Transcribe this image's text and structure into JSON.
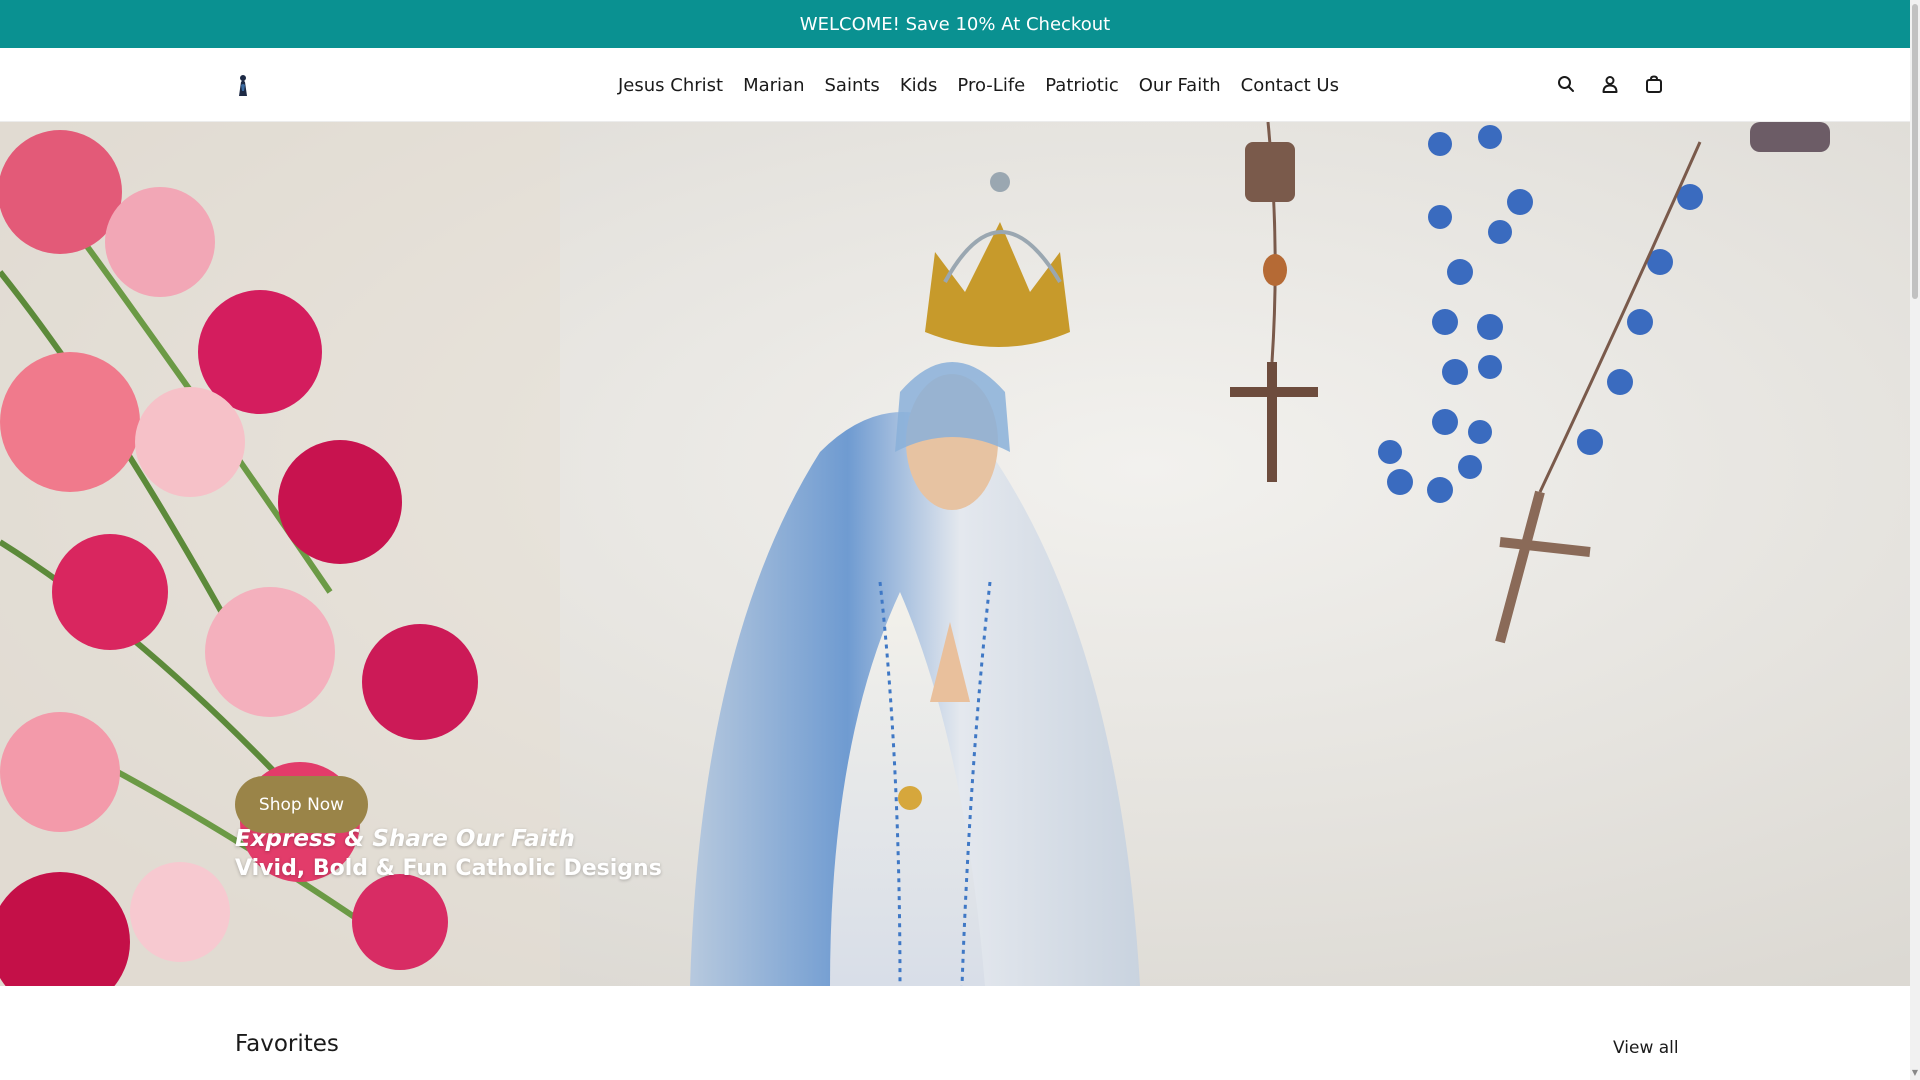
{
  "announcement": {
    "text": "WELCOME! Save 10% At Checkout"
  },
  "header": {
    "nav": [
      "Jesus Christ",
      "Marian",
      "Saints",
      "Kids",
      "Pro-Life",
      "Patriotic",
      "Our Faith",
      "Contact Us"
    ],
    "icons": [
      "search-icon",
      "account-icon",
      "cart-icon"
    ]
  },
  "hero": {
    "title": "Express & Share Our Faith",
    "subtitle": "Vivid, Bold & Fun Catholic Designs",
    "cta": "Shop Now"
  },
  "favorites": {
    "title": "Favorites",
    "view_all": "View all"
  },
  "colors": {
    "announcement_bg": "#0a9191",
    "cta_bg": "#9a8448"
  }
}
